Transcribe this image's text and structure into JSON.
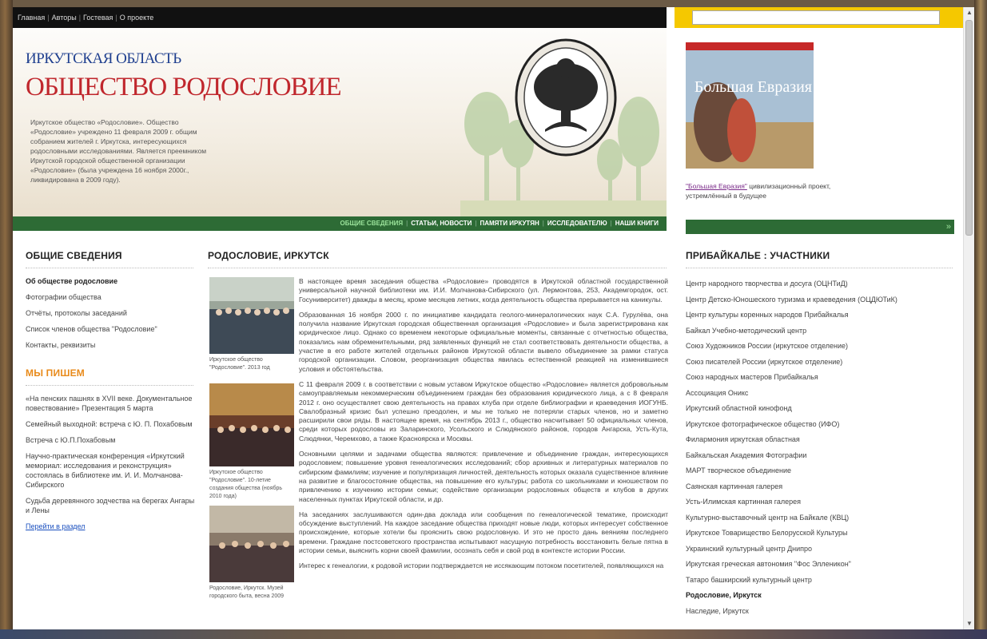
{
  "topnav": [
    "Главная",
    "Авторы",
    "Гостевая",
    "О проекте"
  ],
  "header": {
    "region": "ИРКУТСКАЯ ОБЛАСТЬ",
    "society": "ОБЩЕСТВО РОДОСЛОВИЕ",
    "intro": "Иркутское общество «Родословие». Общество «Родословие» учреждено 11 февраля 2009 г. общим собранием жителей г. Иркутска, интересующихся родословными исследованиями. Является преемником Иркутской городской общественной организации «Родословие» (была учреждена 16 ноября 2000г., ликвидирована в 2009 году)."
  },
  "nav": {
    "items": [
      "ОБЩИЕ СВЕДЕНИЯ",
      "СТАТЬИ, НОВОСТИ",
      "ПАМЯТИ ИРКУТЯН",
      "ИССЛЕДОВАТЕЛЮ",
      "НАШИ КНИГИ"
    ],
    "active_color": "#9be39b"
  },
  "sidebar": {
    "general_title": "ОБЩИЕ СВЕДЕНИЯ",
    "general_links": [
      "Об обществе родословие",
      "Фотографии общества",
      "Отчёты, протоколы заседаний",
      "Список членов общества \"Родословие\"",
      "Контакты, реквизиты"
    ],
    "writing_title": "МЫ ПИШЕМ",
    "writing_links": [
      "«На пенских пашнях в XVII веке. Документальное повествование» Презентация 5 марта",
      "Семейный выходной: встреча с Ю. П. Похабовым",
      "Встреча с Ю.П.Похабовым",
      "Научно-практическая конференция «Иркутский мемориал: исследования и реконструкция» состоялась в библиотеке им. И. И. Молчанова-Сибирского",
      "Судьба деревянного зодчества на берегах Ангары и Лены"
    ],
    "more_link": "Перейти в раздел"
  },
  "main": {
    "title": "РОДОСЛОВИЕ, ИРКУТСК",
    "captions": [
      "Иркутское общество \"Родословие\". 2013 год",
      "Иркутское общество \"Родословие\". 10-летие создания общества (ноябрь 2010 года)",
      "Родословие, Иркутск. Музей городского быта, весна 2009"
    ],
    "paragraphs": [
      "В настоящее время заседания общества «Родословие» проводятся в Иркутской областной государственной универсальной научной библиотеки им. И.И. Молчанова-Сибирского (ул. Лермонтова, 253, Академгородок, ост. Госуниверситет) дважды в месяц, кроме месяцев летних, когда деятельность общества прерывается на каникулы.",
      "Образованная 16 ноября 2000 г. по инициативе кандидата геолого-минералогических наук С.А. Гурулёва, она получила название Иркутская городская общественная организация «Родословие» и была зарегистрирована как юридическое лицо. Однако со временем некоторые официальные моменты, связанные с отчетностью общества, показались нам обременительными, ряд заявленных функций не стал соответствовать деятельности общества, а участие в его работе жителей отдельных районов Иркутской области вывело объединение за рамки статуса городской организации. Словом, реорганизация общества явилась естественной реакцией на изменившиеся условия и обстоятельства.",
      "С 11 февраля 2009 г. в соответствии с новым уставом Иркутское общество «Родословие» является добровольным самоуправляемым некоммерческим объединением граждан без образования юридического лица, а с 8 февраля 2012 г. оно осуществляет свою деятельность на правах клуба при отделе библиографии и краеведения ИОГУНБ. Свалобразный кризис был успешно преодолен, и мы не только не потеряли старых членов, но и заметно расширили свои ряды. В настоящее время, на сентябрь 2013 г., общество насчитывает 50 официальных членов, среди которых родословы из Заларинского, Усольского и Слюдянского районов, городов Ангарска, Усть-Кута, Слюдянки, Черемхово, а также Красноярска и Москвы.",
      "Основными целями и задачами общества являются: привлечение и объединение граждан, интересующихся родословием; повышение уровня генеалогических исследований; сбор архивных и литературных материалов по сибирским фамилиям; изучение и популяризация личностей, деятельность которых оказала существенное влияние на развитие и благосостояние общества, на повышение его культуры; работа со школьниками и юношеством по привлечению к изучению истории семьи; содействие организации родословных обществ и клубов в других населенных пунктах Иркутской области, и др.",
      "На заседаниях заслушиваются один-два доклада или сообщения по генеалогической тематике, происходит обсуждение выступлений. На каждое заседание общества приходят новые люди, которых интересует собственное происхождение, которые хотели бы прояснить свою родословную. И это не просто дань веяниям последнего времени. Граждане постсоветского пространства испытывают насущную потребность восстановить белые пятна в истории семьи, выяснить корни своей фамилии, осознать себя и свой род в контексте истории России.",
      "Интерес к генеалогии, к родовой истории подтверждается не иссякающим потоком посетителей, появляющихся на"
    ]
  },
  "right": {
    "banner_top": "Большая Евразия",
    "banner_link": "\"Большая Евразия\"",
    "banner_text": " цивилизационный проект, устремлённый в будущее",
    "arrow": "»",
    "participants_title": "ПРИБАЙКАЛЬЕ : УЧАСТНИКИ",
    "participants": [
      "Центр народного творчества и досуга (ОЦНТиД)",
      "Центр Детско-Юношеского туризма и краеведения (ОЦДЮТиК)",
      "Центр культуры коренных народов Прибайкалья",
      "Байкал Учебно-методический центр",
      "Союз Художников России (иркутское отделение)",
      "Союз писателей России (иркутское отделение)",
      "Союз народных мастеров Прибайкалья",
      "Ассоциация Оникс",
      "Иркутский областной кинофонд",
      "Иркутское фотографическое общество (ИФО)",
      "Филармония иркутская областная",
      "Байкальская Академия Фотографии",
      "МАРТ творческое объединение",
      "Саянская картинная галерея",
      "Усть-Илимская картинная галерея",
      "Культурно-выставочный центр на Байкале (КВЦ)",
      "Иркутское Товарищество Белорусской Культуры",
      "Украинский культурный центр Днипро",
      "Иркутская греческая автономия \"Фос Элленикон\"",
      "Татаро башкирский культурный центр",
      "Родословие, Иркутск",
      "Наследие, Иркутск"
    ]
  }
}
